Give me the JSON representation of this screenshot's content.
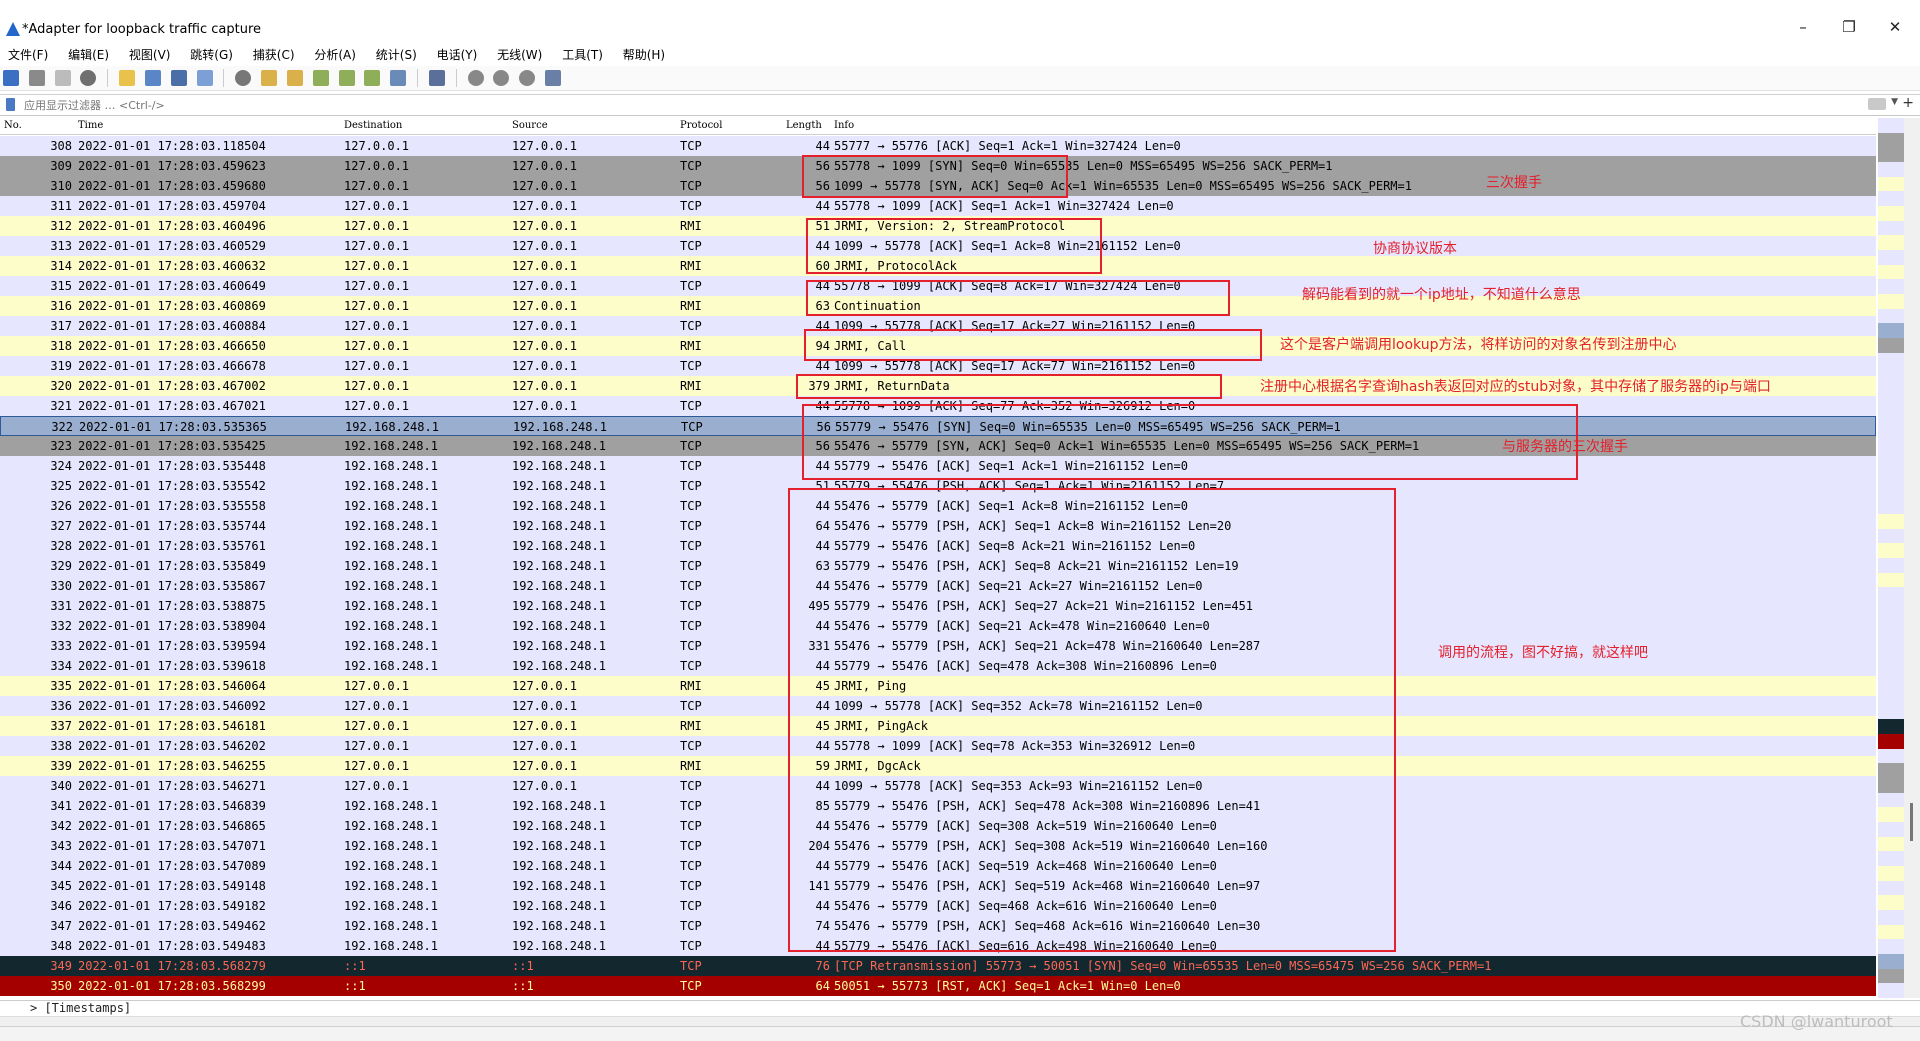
{
  "window": {
    "title": "*Adapter for loopback traffic capture",
    "minimize": "–",
    "restore": "❐",
    "close": "✕"
  },
  "menu": [
    "文件(F)",
    "编辑(E)",
    "视图(V)",
    "跳转(G)",
    "捕获(C)",
    "分析(A)",
    "统计(S)",
    "电话(Y)",
    "无线(W)",
    "工具(T)",
    "帮助(H)"
  ],
  "filter": {
    "placeholder": "应用显示过滤器 … <Ctrl-/>",
    "value": "",
    "dropdown": "▼",
    "add": "+"
  },
  "columns": {
    "no": "No.",
    "time": "Time",
    "destination": "Destination",
    "source": "Source",
    "protocol": "Protocol",
    "length": "Length",
    "info": "Info"
  },
  "packets": [
    {
      "no": "308",
      "time": "2022-01-01 17:28:03.118504",
      "dst": "127.0.0.1",
      "src": "127.0.0.1",
      "proto": "TCP",
      "len": "44",
      "info": "55777 → 55776 [ACK] Seq=1 Ack=1 Win=327424 Len=0",
      "style": "lav"
    },
    {
      "no": "309",
      "time": "2022-01-01 17:28:03.459623",
      "dst": "127.0.0.1",
      "src": "127.0.0.1",
      "proto": "TCP",
      "len": "56",
      "info": "55778 → 1099 [SYN] Seq=0 Win=65535 Len=0 MSS=65495 WS=256 SACK_PERM=1",
      "style": "gray"
    },
    {
      "no": "310",
      "time": "2022-01-01 17:28:03.459680",
      "dst": "127.0.0.1",
      "src": "127.0.0.1",
      "proto": "TCP",
      "len": "56",
      "info": "1099 → 55778 [SYN, ACK] Seq=0 Ack=1 Win=65535 Len=0 MSS=65495 WS=256 SACK_PERM=1",
      "style": "gray"
    },
    {
      "no": "311",
      "time": "2022-01-01 17:28:03.459704",
      "dst": "127.0.0.1",
      "src": "127.0.0.1",
      "proto": "TCP",
      "len": "44",
      "info": "55778 → 1099 [ACK] Seq=1 Ack=1 Win=327424 Len=0",
      "style": "lav"
    },
    {
      "no": "312",
      "time": "2022-01-01 17:28:03.460496",
      "dst": "127.0.0.1",
      "src": "127.0.0.1",
      "proto": "RMI",
      "len": "51",
      "info": "JRMI, Version: 2, StreamProtocol",
      "style": "yel"
    },
    {
      "no": "313",
      "time": "2022-01-01 17:28:03.460529",
      "dst": "127.0.0.1",
      "src": "127.0.0.1",
      "proto": "TCP",
      "len": "44",
      "info": "1099 → 55778 [ACK] Seq=1 Ack=8 Win=2161152 Len=0",
      "style": "lav"
    },
    {
      "no": "314",
      "time": "2022-01-01 17:28:03.460632",
      "dst": "127.0.0.1",
      "src": "127.0.0.1",
      "proto": "RMI",
      "len": "60",
      "info": "JRMI, ProtocolAck",
      "style": "yel"
    },
    {
      "no": "315",
      "time": "2022-01-01 17:28:03.460649",
      "dst": "127.0.0.1",
      "src": "127.0.0.1",
      "proto": "TCP",
      "len": "44",
      "info": "55778 → 1099 [ACK] Seq=8 Ack=17 Win=327424 Len=0",
      "style": "lav"
    },
    {
      "no": "316",
      "time": "2022-01-01 17:28:03.460869",
      "dst": "127.0.0.1",
      "src": "127.0.0.1",
      "proto": "RMI",
      "len": "63",
      "info": "Continuation",
      "style": "yel"
    },
    {
      "no": "317",
      "time": "2022-01-01 17:28:03.460884",
      "dst": "127.0.0.1",
      "src": "127.0.0.1",
      "proto": "TCP",
      "len": "44",
      "info": "1099 → 55778 [ACK] Seq=17 Ack=27 Win=2161152 Len=0",
      "style": "lav"
    },
    {
      "no": "318",
      "time": "2022-01-01 17:28:03.466650",
      "dst": "127.0.0.1",
      "src": "127.0.0.1",
      "proto": "RMI",
      "len": "94",
      "info": "JRMI, Call",
      "style": "yel"
    },
    {
      "no": "319",
      "time": "2022-01-01 17:28:03.466678",
      "dst": "127.0.0.1",
      "src": "127.0.0.1",
      "proto": "TCP",
      "len": "44",
      "info": "1099 → 55778 [ACK] Seq=17 Ack=77 Win=2161152 Len=0",
      "style": "lav"
    },
    {
      "no": "320",
      "time": "2022-01-01 17:28:03.467002",
      "dst": "127.0.0.1",
      "src": "127.0.0.1",
      "proto": "RMI",
      "len": "379",
      "info": "JRMI, ReturnData",
      "style": "yel"
    },
    {
      "no": "321",
      "time": "2022-01-01 17:28:03.467021",
      "dst": "127.0.0.1",
      "src": "127.0.0.1",
      "proto": "TCP",
      "len": "44",
      "info": "55778 → 1099 [ACK] Seq=77 Ack=352 Win=326912 Len=0",
      "style": "lav"
    },
    {
      "no": "322",
      "time": "2022-01-01 17:28:03.535365",
      "dst": "192.168.248.1",
      "src": "192.168.248.1",
      "proto": "TCP",
      "len": "56",
      "info": "55779 → 55476 [SYN] Seq=0 Win=65535 Len=0 MSS=65495 WS=256 SACK_PERM=1",
      "style": "sel"
    },
    {
      "no": "323",
      "time": "2022-01-01 17:28:03.535425",
      "dst": "192.168.248.1",
      "src": "192.168.248.1",
      "proto": "TCP",
      "len": "56",
      "info": "55476 → 55779 [SYN, ACK] Seq=0 Ack=1 Win=65535 Len=0 MSS=65495 WS=256 SACK_PERM=1",
      "style": "gray"
    },
    {
      "no": "324",
      "time": "2022-01-01 17:28:03.535448",
      "dst": "192.168.248.1",
      "src": "192.168.248.1",
      "proto": "TCP",
      "len": "44",
      "info": "55779 → 55476 [ACK] Seq=1 Ack=1 Win=2161152 Len=0",
      "style": "lav"
    },
    {
      "no": "325",
      "time": "2022-01-01 17:28:03.535542",
      "dst": "192.168.248.1",
      "src": "192.168.248.1",
      "proto": "TCP",
      "len": "51",
      "info": "55779 → 55476 [PSH, ACK] Seq=1 Ack=1 Win=2161152 Len=7",
      "style": "lav"
    },
    {
      "no": "326",
      "time": "2022-01-01 17:28:03.535558",
      "dst": "192.168.248.1",
      "src": "192.168.248.1",
      "proto": "TCP",
      "len": "44",
      "info": "55476 → 55779 [ACK] Seq=1 Ack=8 Win=2161152 Len=0",
      "style": "lav"
    },
    {
      "no": "327",
      "time": "2022-01-01 17:28:03.535744",
      "dst": "192.168.248.1",
      "src": "192.168.248.1",
      "proto": "TCP",
      "len": "64",
      "info": "55476 → 55779 [PSH, ACK] Seq=1 Ack=8 Win=2161152 Len=20",
      "style": "lav"
    },
    {
      "no": "328",
      "time": "2022-01-01 17:28:03.535761",
      "dst": "192.168.248.1",
      "src": "192.168.248.1",
      "proto": "TCP",
      "len": "44",
      "info": "55779 → 55476 [ACK] Seq=8 Ack=21 Win=2161152 Len=0",
      "style": "lav"
    },
    {
      "no": "329",
      "time": "2022-01-01 17:28:03.535849",
      "dst": "192.168.248.1",
      "src": "192.168.248.1",
      "proto": "TCP",
      "len": "63",
      "info": "55779 → 55476 [PSH, ACK] Seq=8 Ack=21 Win=2161152 Len=19",
      "style": "lav"
    },
    {
      "no": "330",
      "time": "2022-01-01 17:28:03.535867",
      "dst": "192.168.248.1",
      "src": "192.168.248.1",
      "proto": "TCP",
      "len": "44",
      "info": "55476 → 55779 [ACK] Seq=21 Ack=27 Win=2161152 Len=0",
      "style": "lav"
    },
    {
      "no": "331",
      "time": "2022-01-01 17:28:03.538875",
      "dst": "192.168.248.1",
      "src": "192.168.248.1",
      "proto": "TCP",
      "len": "495",
      "info": "55779 → 55476 [PSH, ACK] Seq=27 Ack=21 Win=2161152 Len=451",
      "style": "lav"
    },
    {
      "no": "332",
      "time": "2022-01-01 17:28:03.538904",
      "dst": "192.168.248.1",
      "src": "192.168.248.1",
      "proto": "TCP",
      "len": "44",
      "info": "55476 → 55779 [ACK] Seq=21 Ack=478 Win=2160640 Len=0",
      "style": "lav"
    },
    {
      "no": "333",
      "time": "2022-01-01 17:28:03.539594",
      "dst": "192.168.248.1",
      "src": "192.168.248.1",
      "proto": "TCP",
      "len": "331",
      "info": "55476 → 55779 [PSH, ACK] Seq=21 Ack=478 Win=2160640 Len=287",
      "style": "lav"
    },
    {
      "no": "334",
      "time": "2022-01-01 17:28:03.539618",
      "dst": "192.168.248.1",
      "src": "192.168.248.1",
      "proto": "TCP",
      "len": "44",
      "info": "55779 → 55476 [ACK] Seq=478 Ack=308 Win=2160896 Len=0",
      "style": "lav"
    },
    {
      "no": "335",
      "time": "2022-01-01 17:28:03.546064",
      "dst": "127.0.0.1",
      "src": "127.0.0.1",
      "proto": "RMI",
      "len": "45",
      "info": "JRMI, Ping",
      "style": "yel"
    },
    {
      "no": "336",
      "time": "2022-01-01 17:28:03.546092",
      "dst": "127.0.0.1",
      "src": "127.0.0.1",
      "proto": "TCP",
      "len": "44",
      "info": "1099 → 55778 [ACK] Seq=352 Ack=78 Win=2161152 Len=0",
      "style": "lav"
    },
    {
      "no": "337",
      "time": "2022-01-01 17:28:03.546181",
      "dst": "127.0.0.1",
      "src": "127.0.0.1",
      "proto": "RMI",
      "len": "45",
      "info": "JRMI, PingAck",
      "style": "yel"
    },
    {
      "no": "338",
      "time": "2022-01-01 17:28:03.546202",
      "dst": "127.0.0.1",
      "src": "127.0.0.1",
      "proto": "TCP",
      "len": "44",
      "info": "55778 → 1099 [ACK] Seq=78 Ack=353 Win=326912 Len=0",
      "style": "lav"
    },
    {
      "no": "339",
      "time": "2022-01-01 17:28:03.546255",
      "dst": "127.0.0.1",
      "src": "127.0.0.1",
      "proto": "RMI",
      "len": "59",
      "info": "JRMI, DgcAck",
      "style": "yel"
    },
    {
      "no": "340",
      "time": "2022-01-01 17:28:03.546271",
      "dst": "127.0.0.1",
      "src": "127.0.0.1",
      "proto": "TCP",
      "len": "44",
      "info": "1099 → 55778 [ACK] Seq=353 Ack=93 Win=2161152 Len=0",
      "style": "lav"
    },
    {
      "no": "341",
      "time": "2022-01-01 17:28:03.546839",
      "dst": "192.168.248.1",
      "src": "192.168.248.1",
      "proto": "TCP",
      "len": "85",
      "info": "55779 → 55476 [PSH, ACK] Seq=478 Ack=308 Win=2160896 Len=41",
      "style": "lav"
    },
    {
      "no": "342",
      "time": "2022-01-01 17:28:03.546865",
      "dst": "192.168.248.1",
      "src": "192.168.248.1",
      "proto": "TCP",
      "len": "44",
      "info": "55476 → 55779 [ACK] Seq=308 Ack=519 Win=2160640 Len=0",
      "style": "lav"
    },
    {
      "no": "343",
      "time": "2022-01-01 17:28:03.547071",
      "dst": "192.168.248.1",
      "src": "192.168.248.1",
      "proto": "TCP",
      "len": "204",
      "info": "55476 → 55779 [PSH, ACK] Seq=308 Ack=519 Win=2160640 Len=160",
      "style": "lav"
    },
    {
      "no": "344",
      "time": "2022-01-01 17:28:03.547089",
      "dst": "192.168.248.1",
      "src": "192.168.248.1",
      "proto": "TCP",
      "len": "44",
      "info": "55779 → 55476 [ACK] Seq=519 Ack=468 Win=2160640 Len=0",
      "style": "lav"
    },
    {
      "no": "345",
      "time": "2022-01-01 17:28:03.549148",
      "dst": "192.168.248.1",
      "src": "192.168.248.1",
      "proto": "TCP",
      "len": "141",
      "info": "55779 → 55476 [PSH, ACK] Seq=519 Ack=468 Win=2160640 Len=97",
      "style": "lav"
    },
    {
      "no": "346",
      "time": "2022-01-01 17:28:03.549182",
      "dst": "192.168.248.1",
      "src": "192.168.248.1",
      "proto": "TCP",
      "len": "44",
      "info": "55476 → 55779 [ACK] Seq=468 Ack=616 Win=2160640 Len=0",
      "style": "lav"
    },
    {
      "no": "347",
      "time": "2022-01-01 17:28:03.549462",
      "dst": "192.168.248.1",
      "src": "192.168.248.1",
      "proto": "TCP",
      "len": "74",
      "info": "55476 → 55779 [PSH, ACK] Seq=468 Ack=616 Win=2160640 Len=30",
      "style": "lav"
    },
    {
      "no": "348",
      "time": "2022-01-01 17:28:03.549483",
      "dst": "192.168.248.1",
      "src": "192.168.248.1",
      "proto": "TCP",
      "len": "44",
      "info": "55779 → 55476 [ACK] Seq=616 Ack=498 Win=2160640 Len=0",
      "style": "lav"
    },
    {
      "no": "349",
      "time": "2022-01-01 17:28:03.568279",
      "dst": "::1",
      "src": "::1",
      "proto": "TCP",
      "len": "76",
      "info": "[TCP Retransmission] 55773 → 50051 [SYN] Seq=0 Win=65535 Len=0 MSS=65475 WS=256 SACK_PERM=1",
      "style": "black"
    },
    {
      "no": "350",
      "time": "2022-01-01 17:28:03.568299",
      "dst": "::1",
      "src": "::1",
      "proto": "TCP",
      "len": "64",
      "info": "50051 → 55773 [RST, ACK] Seq=1 Ack=1 Win=0 Len=0",
      "style": "red"
    }
  ],
  "annotations": {
    "handshake3": "三次握手",
    "negotiate": "协商协议版本",
    "ip_only": "解码能看到的就一个ip地址，不知道什么意思",
    "lookup": "这个是客户端调用lookup方法，将样访问的对象名传到注册中心",
    "registry": "注册中心根据名字查询hash表返回对应的stub对象，其中存储了服务器的ip与端口",
    "server_handshake": "与服务器的三次握手",
    "call_flow": "调用的流程，图不好搞，就这样吧"
  },
  "detail": {
    "line": "> [Timestamps]"
  },
  "status": {
    "left": "",
    "right": ""
  },
  "watermark": "CSDN @lwanturoot"
}
